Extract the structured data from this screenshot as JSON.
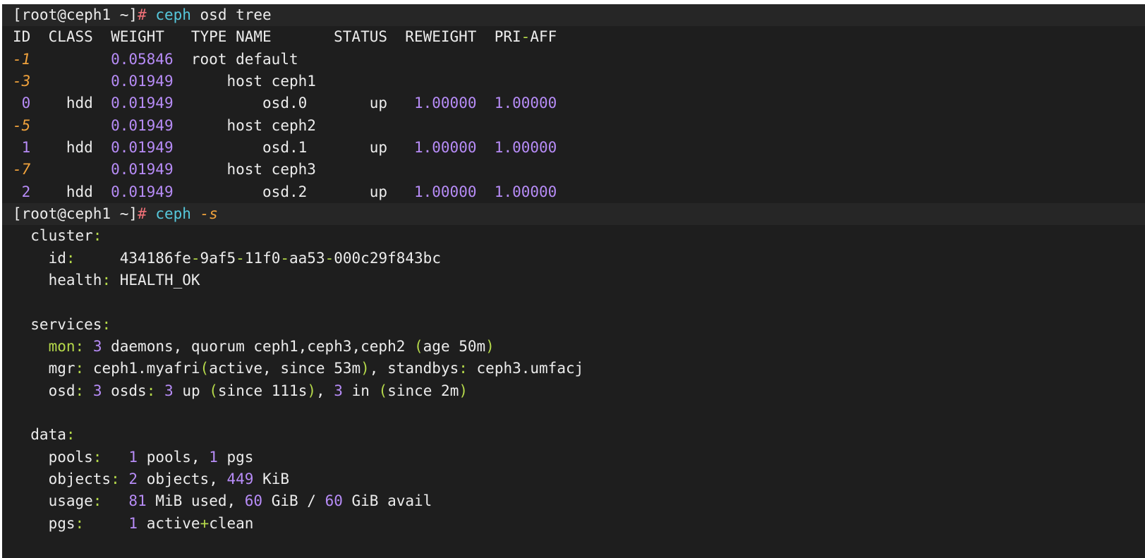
{
  "colors": {
    "background": "#1e1e1e",
    "prompt_bar": "#262626",
    "text": "#ececec",
    "command": "#56c8dc",
    "prompt_hash": "#f07178",
    "negative_id": "#f0a23c",
    "number": "#b78cf7",
    "punctuation": "#b5d94a"
  },
  "terminal": {
    "lines": [
      {
        "prompt": true,
        "tokens": [
          {
            "t": "[root@ceph1 ~]",
            "c": "white"
          },
          {
            "t": "# ",
            "c": "red"
          },
          {
            "t": "ceph",
            "c": "cyan"
          },
          {
            "t": " osd tree",
            "c": "white"
          }
        ]
      },
      {
        "tokens": [
          {
            "t": "ID  CLASS  WEIGHT   TYPE NAME       STATUS  REWEIGHT  PRI",
            "c": "white"
          },
          {
            "t": "-",
            "c": "green"
          },
          {
            "t": "AFF",
            "c": "white"
          }
        ]
      },
      {
        "tokens": [
          {
            "t": "-1",
            "c": "orange"
          },
          {
            "t": "         ",
            "c": "white"
          },
          {
            "t": "0.05846",
            "c": "purple"
          },
          {
            "t": "  root default",
            "c": "white"
          }
        ]
      },
      {
        "tokens": [
          {
            "t": "-3",
            "c": "orange"
          },
          {
            "t": "         ",
            "c": "white"
          },
          {
            "t": "0.01949",
            "c": "purple"
          },
          {
            "t": "      host ceph1",
            "c": "white"
          }
        ]
      },
      {
        "tokens": [
          {
            "t": " 0",
            "c": "purple"
          },
          {
            "t": "    hdd  ",
            "c": "white"
          },
          {
            "t": "0.01949",
            "c": "purple"
          },
          {
            "t": "          osd.0       up   ",
            "c": "white"
          },
          {
            "t": "1.00000",
            "c": "purple"
          },
          {
            "t": "  ",
            "c": "white"
          },
          {
            "t": "1.00000",
            "c": "purple"
          }
        ]
      },
      {
        "tokens": [
          {
            "t": "-5",
            "c": "orange"
          },
          {
            "t": "         ",
            "c": "white"
          },
          {
            "t": "0.01949",
            "c": "purple"
          },
          {
            "t": "      host ceph2",
            "c": "white"
          }
        ]
      },
      {
        "tokens": [
          {
            "t": " 1",
            "c": "purple"
          },
          {
            "t": "    hdd  ",
            "c": "white"
          },
          {
            "t": "0.01949",
            "c": "purple"
          },
          {
            "t": "          osd.1       up   ",
            "c": "white"
          },
          {
            "t": "1.00000",
            "c": "purple"
          },
          {
            "t": "  ",
            "c": "white"
          },
          {
            "t": "1.00000",
            "c": "purple"
          }
        ]
      },
      {
        "tokens": [
          {
            "t": "-7",
            "c": "orange"
          },
          {
            "t": "         ",
            "c": "white"
          },
          {
            "t": "0.01949",
            "c": "purple"
          },
          {
            "t": "      host ceph3",
            "c": "white"
          }
        ]
      },
      {
        "tokens": [
          {
            "t": " 2",
            "c": "purple"
          },
          {
            "t": "    hdd  ",
            "c": "white"
          },
          {
            "t": "0.01949",
            "c": "purple"
          },
          {
            "t": "          osd.2       up   ",
            "c": "white"
          },
          {
            "t": "1.00000",
            "c": "purple"
          },
          {
            "t": "  ",
            "c": "white"
          },
          {
            "t": "1.00000",
            "c": "purple"
          }
        ]
      },
      {
        "prompt": true,
        "tokens": [
          {
            "t": "[root@ceph1 ~]",
            "c": "white"
          },
          {
            "t": "# ",
            "c": "red"
          },
          {
            "t": "ceph",
            "c": "cyan"
          },
          {
            "t": " ",
            "c": "white"
          },
          {
            "t": "-s",
            "c": "orange"
          }
        ]
      },
      {
        "tokens": [
          {
            "t": "  cluster",
            "c": "white"
          },
          {
            "t": ":",
            "c": "green"
          }
        ]
      },
      {
        "tokens": [
          {
            "t": "    id",
            "c": "white"
          },
          {
            "t": ":",
            "c": "green"
          },
          {
            "t": "     434186fe",
            "c": "white"
          },
          {
            "t": "-",
            "c": "green"
          },
          {
            "t": "9af5",
            "c": "white"
          },
          {
            "t": "-",
            "c": "green"
          },
          {
            "t": "11f0",
            "c": "white"
          },
          {
            "t": "-",
            "c": "green"
          },
          {
            "t": "aa53",
            "c": "white"
          },
          {
            "t": "-",
            "c": "green"
          },
          {
            "t": "000c29f843bc",
            "c": "white"
          }
        ]
      },
      {
        "tokens": [
          {
            "t": "    health",
            "c": "white"
          },
          {
            "t": ":",
            "c": "green"
          },
          {
            "t": " HEALTH_OK",
            "c": "white"
          }
        ]
      },
      {
        "tokens": [
          {
            "t": " ",
            "c": "white"
          }
        ]
      },
      {
        "tokens": [
          {
            "t": "  services",
            "c": "white"
          },
          {
            "t": ":",
            "c": "green"
          }
        ]
      },
      {
        "tokens": [
          {
            "t": "    mon",
            "c": "green"
          },
          {
            "t": ":",
            "c": "green"
          },
          {
            "t": " ",
            "c": "white"
          },
          {
            "t": "3",
            "c": "purple"
          },
          {
            "t": " daemons, quorum ceph1,ceph3,ceph2 ",
            "c": "white"
          },
          {
            "t": "(",
            "c": "green"
          },
          {
            "t": "age 50m",
            "c": "white"
          },
          {
            "t": ")",
            "c": "green"
          }
        ]
      },
      {
        "tokens": [
          {
            "t": "    mgr",
            "c": "white"
          },
          {
            "t": ":",
            "c": "green"
          },
          {
            "t": " ceph1.myafri",
            "c": "white"
          },
          {
            "t": "(",
            "c": "green"
          },
          {
            "t": "active, since 53m",
            "c": "white"
          },
          {
            "t": ")",
            "c": "green"
          },
          {
            "t": ", standbys",
            "c": "white"
          },
          {
            "t": ":",
            "c": "green"
          },
          {
            "t": " ceph3.umfacj",
            "c": "white"
          }
        ]
      },
      {
        "tokens": [
          {
            "t": "    osd",
            "c": "white"
          },
          {
            "t": ":",
            "c": "green"
          },
          {
            "t": " ",
            "c": "white"
          },
          {
            "t": "3",
            "c": "purple"
          },
          {
            "t": " osds",
            "c": "white"
          },
          {
            "t": ":",
            "c": "green"
          },
          {
            "t": " ",
            "c": "white"
          },
          {
            "t": "3",
            "c": "purple"
          },
          {
            "t": " up ",
            "c": "white"
          },
          {
            "t": "(",
            "c": "green"
          },
          {
            "t": "since 111s",
            "c": "white"
          },
          {
            "t": ")",
            "c": "green"
          },
          {
            "t": ", ",
            "c": "white"
          },
          {
            "t": "3",
            "c": "purple"
          },
          {
            "t": " in ",
            "c": "white"
          },
          {
            "t": "(",
            "c": "green"
          },
          {
            "t": "since 2m",
            "c": "white"
          },
          {
            "t": ")",
            "c": "green"
          }
        ]
      },
      {
        "tokens": [
          {
            "t": " ",
            "c": "white"
          }
        ]
      },
      {
        "tokens": [
          {
            "t": "  data",
            "c": "white"
          },
          {
            "t": ":",
            "c": "green"
          }
        ]
      },
      {
        "tokens": [
          {
            "t": "    pools",
            "c": "white"
          },
          {
            "t": ":",
            "c": "green"
          },
          {
            "t": "   ",
            "c": "white"
          },
          {
            "t": "1",
            "c": "purple"
          },
          {
            "t": " pools, ",
            "c": "white"
          },
          {
            "t": "1",
            "c": "purple"
          },
          {
            "t": " pgs",
            "c": "white"
          }
        ]
      },
      {
        "tokens": [
          {
            "t": "    objects",
            "c": "white"
          },
          {
            "t": ":",
            "c": "green"
          },
          {
            "t": " ",
            "c": "white"
          },
          {
            "t": "2",
            "c": "purple"
          },
          {
            "t": " objects, ",
            "c": "white"
          },
          {
            "t": "449",
            "c": "purple"
          },
          {
            "t": " KiB",
            "c": "white"
          }
        ]
      },
      {
        "tokens": [
          {
            "t": "    usage",
            "c": "white"
          },
          {
            "t": ":",
            "c": "green"
          },
          {
            "t": "   ",
            "c": "white"
          },
          {
            "t": "81",
            "c": "purple"
          },
          {
            "t": " MiB used, ",
            "c": "white"
          },
          {
            "t": "60",
            "c": "purple"
          },
          {
            "t": " GiB / ",
            "c": "white"
          },
          {
            "t": "60",
            "c": "purple"
          },
          {
            "t": " GiB avail",
            "c": "white"
          }
        ]
      },
      {
        "tokens": [
          {
            "t": "    pgs",
            "c": "white"
          },
          {
            "t": ":",
            "c": "green"
          },
          {
            "t": "     ",
            "c": "white"
          },
          {
            "t": "1",
            "c": "purple"
          },
          {
            "t": " active",
            "c": "white"
          },
          {
            "t": "+",
            "c": "green"
          },
          {
            "t": "clean",
            "c": "white"
          }
        ]
      }
    ]
  }
}
